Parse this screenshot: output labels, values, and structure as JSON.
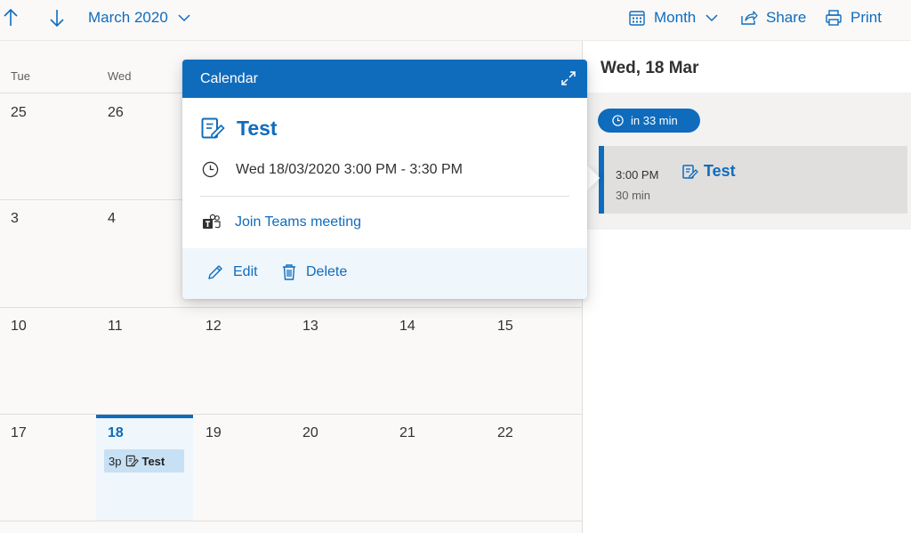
{
  "toolbar": {
    "up_icon": "arrow-up-icon",
    "down_icon": "arrow-down-icon",
    "month_year": "March 2020",
    "view_label": "Month",
    "share_label": "Share",
    "print_label": "Print"
  },
  "grid": {
    "day_headers": [
      "Tue",
      "Wed"
    ],
    "weeks": [
      [
        "25",
        "26"
      ],
      [
        "3",
        "4"
      ],
      [
        "10",
        "11",
        "12",
        "13",
        "14",
        "15"
      ],
      [
        "17",
        "18",
        "19",
        "20",
        "21",
        "22"
      ]
    ],
    "today": "18",
    "event_chip": {
      "time": "3p",
      "title": "Test"
    }
  },
  "popup": {
    "header": "Calendar",
    "title": "Test",
    "datetime": "Wed 18/03/2020 3:00 PM - 3:30 PM",
    "teams_link": "Join Teams meeting",
    "edit_label": "Edit",
    "delete_label": "Delete"
  },
  "agenda": {
    "date_title": "Wed, 18 Mar",
    "countdown": "in 33 min",
    "item": {
      "time": "3:00 PM",
      "duration": "30 min",
      "title": "Test"
    }
  },
  "colors": {
    "accent": "#0f6cbd",
    "pane_bg": "#faf9f8",
    "today_bg": "#eff6fc",
    "chip_bg": "#c7e0f4"
  }
}
